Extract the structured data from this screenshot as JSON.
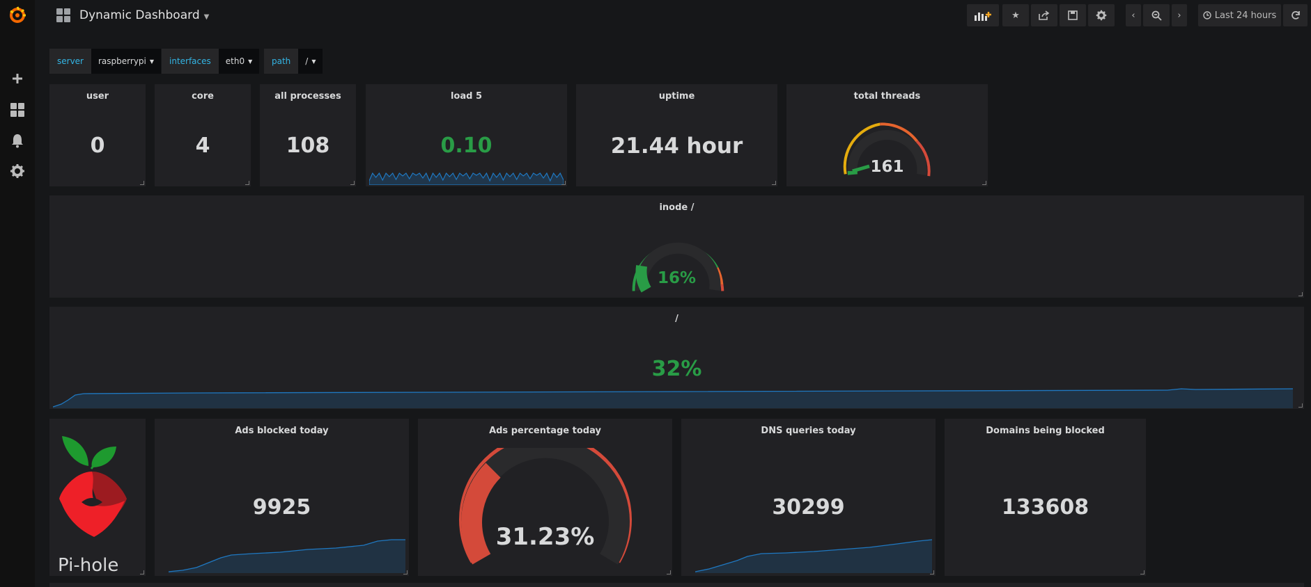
{
  "dashboard": {
    "title": "Dynamic Dashboard"
  },
  "toolbar": {
    "time_range": "Last 24 hours"
  },
  "variables": [
    {
      "label": "server",
      "value": "raspberrypi"
    },
    {
      "label": "interfaces",
      "value": "eth0"
    },
    {
      "label": "path",
      "value": "/"
    }
  ],
  "panels": {
    "user": {
      "title": "user",
      "value": "0"
    },
    "core": {
      "title": "core",
      "value": "4"
    },
    "all_processes": {
      "title": "all processes",
      "value": "108"
    },
    "load5": {
      "title": "load 5",
      "value": "0.10"
    },
    "uptime": {
      "title": "uptime",
      "value": "21.44 hour"
    },
    "total_threads": {
      "title": "total threads",
      "value": "161"
    },
    "inode": {
      "title": "inode /",
      "value": "16%",
      "gauge_fraction": 0.16
    },
    "disk": {
      "title": "/",
      "value": "32%"
    },
    "pihole": {
      "logo_text": "Pi-hole"
    },
    "ads_blocked": {
      "title": "Ads blocked today",
      "value": "9925"
    },
    "ads_percentage": {
      "title": "Ads percentage today",
      "value": "31.23%",
      "gauge_fraction": 0.3123
    },
    "dns_queries": {
      "title": "DNS queries today",
      "value": "30299"
    },
    "domains_blocked": {
      "title": "Domains being blocked",
      "value": "133608"
    }
  },
  "colors": {
    "background": "#161719",
    "panel": "#212124",
    "green": "#299c46",
    "orange": "#e5ac0e",
    "red": "#d44a3a",
    "sparkline": "#1f78c1",
    "variable_label": "#33b5e5"
  },
  "icons": {
    "sidebar": [
      "grafana-logo-icon",
      "plus-icon",
      "dashboards-icon",
      "bell-icon",
      "gear-icon"
    ],
    "toolbar": [
      "add-panel-icon",
      "star-icon",
      "share-icon",
      "save-icon",
      "settings-icon",
      "chevron-left-icon",
      "zoom-out-icon",
      "chevron-right-icon",
      "clock-icon",
      "refresh-icon"
    ]
  }
}
